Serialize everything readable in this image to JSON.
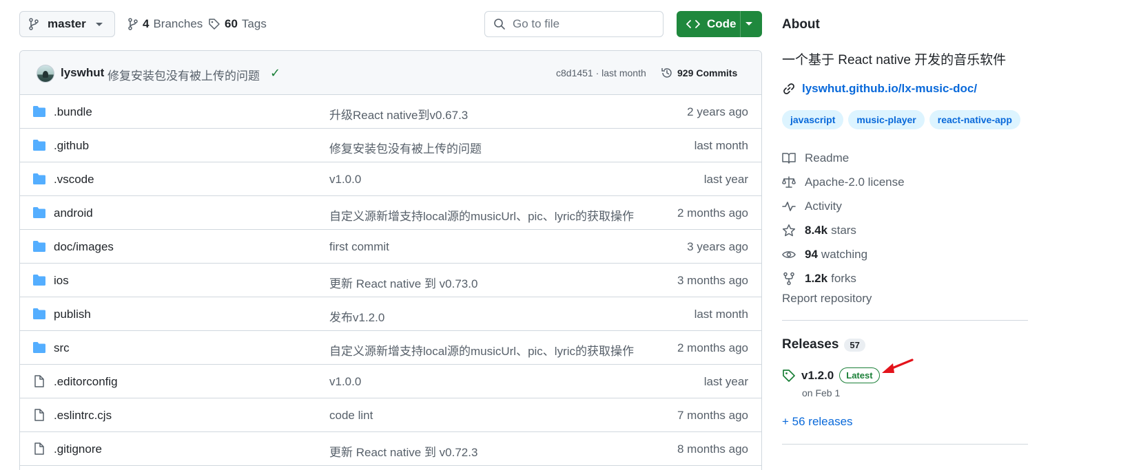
{
  "toolbar": {
    "branch": "master",
    "branches_count": "4",
    "branches_label": "Branches",
    "tags_count": "60",
    "tags_label": "Tags",
    "search_placeholder": "Go to file",
    "code_label": "Code"
  },
  "commit": {
    "author": "lyswhut",
    "message": "修复安装包没有被上传的问题",
    "status": "✓",
    "hash_time": "c8d1451 · last month",
    "commits_count": "929",
    "commits_label": "Commits"
  },
  "files": [
    {
      "type": "folder",
      "name": ".bundle",
      "message": "升级React native到v0.67.3",
      "time": "2 years ago"
    },
    {
      "type": "folder",
      "name": ".github",
      "message": "修复安装包没有被上传的问题",
      "time": "last month"
    },
    {
      "type": "folder",
      "name": ".vscode",
      "message": "v1.0.0",
      "time": "last year"
    },
    {
      "type": "folder",
      "name": "android",
      "message": "自定义源新增支持local源的musicUrl、pic、lyric的获取操作",
      "time": "2 months ago"
    },
    {
      "type": "folder",
      "name": "doc/images",
      "message": "first commit",
      "time": "3 years ago"
    },
    {
      "type": "folder",
      "name": "ios",
      "message": "更新 React native 到 v0.73.0",
      "time": "3 months ago"
    },
    {
      "type": "folder",
      "name": "publish",
      "message": "发布v1.2.0",
      "time": "last month"
    },
    {
      "type": "folder",
      "name": "src",
      "message": "自定义源新增支持local源的musicUrl、pic、lyric的获取操作",
      "time": "2 months ago"
    },
    {
      "type": "file",
      "name": ".editorconfig",
      "message": "v1.0.0",
      "time": "last year"
    },
    {
      "type": "file",
      "name": ".eslintrc.cjs",
      "message": "code lint",
      "time": "7 months ago"
    },
    {
      "type": "file",
      "name": ".gitignore",
      "message": "更新 React native 到 v0.72.3",
      "time": "8 months ago"
    }
  ],
  "about": {
    "heading": "About",
    "description": "一个基于 React native 开发的音乐软件",
    "homepage": "lyswhut.github.io/lx-music-doc/",
    "topics": [
      "javascript",
      "music-player",
      "react-native-app"
    ],
    "readme": "Readme",
    "license": "Apache-2.0 license",
    "activity": "Activity",
    "stars_count": "8.4k",
    "stars_label": "stars",
    "watching_count": "94",
    "watching_label": "watching",
    "forks_count": "1.2k",
    "forks_label": "forks",
    "report": "Report repository"
  },
  "releases": {
    "heading": "Releases",
    "count": "57",
    "latest_version": "v1.2.0",
    "latest_badge": "Latest",
    "latest_date": "on Feb 1",
    "more_link": "+ 56 releases"
  },
  "colors": {
    "accent_link": "#0969da",
    "code_button": "#1f883d",
    "folder_icon": "#54aeff",
    "latest_badge": "#1a7f37",
    "annotation_arrow": "#e3131b"
  }
}
